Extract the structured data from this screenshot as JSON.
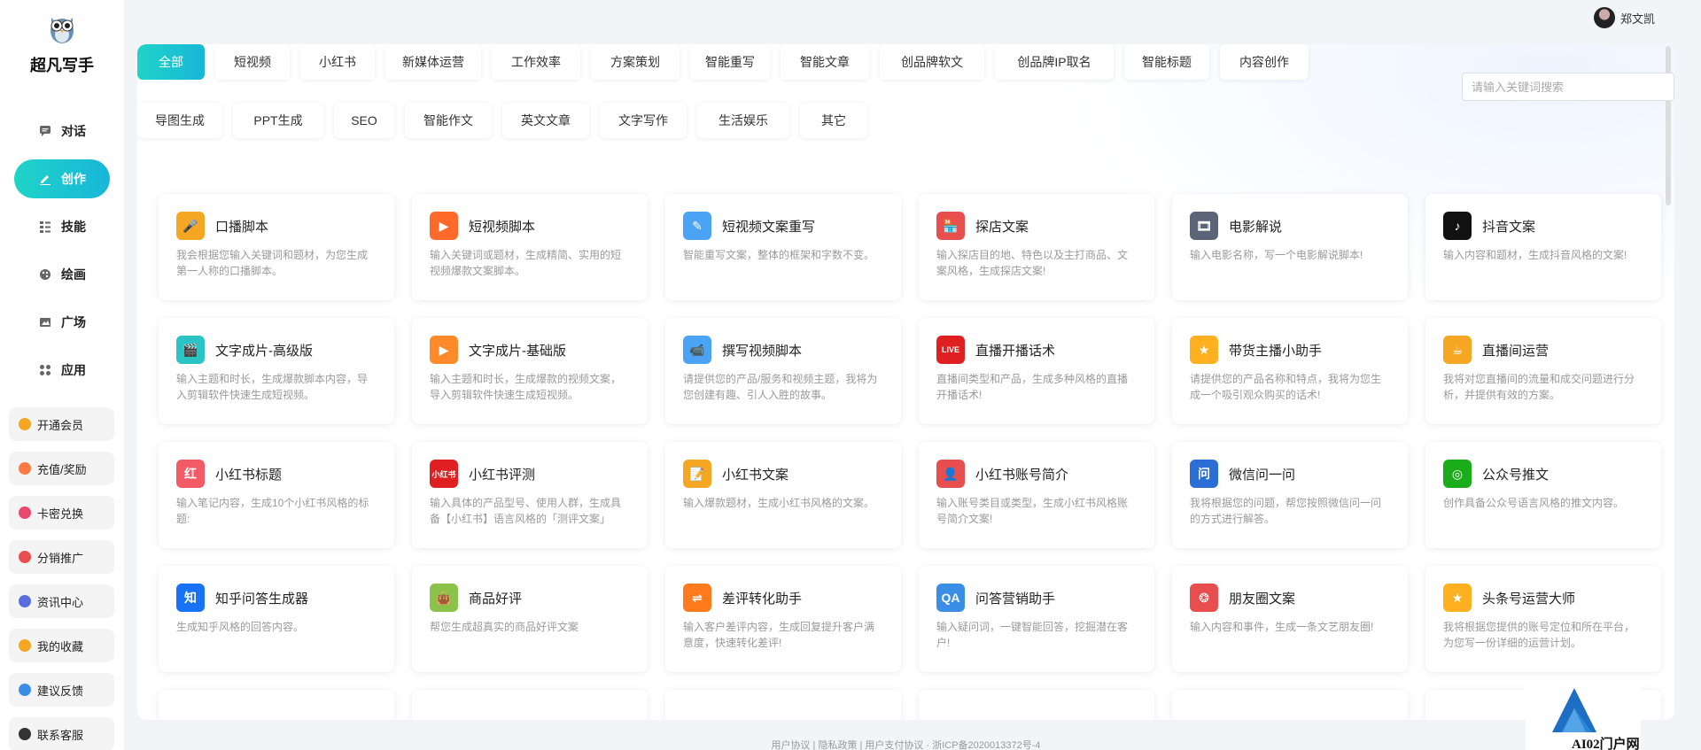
{
  "app": {
    "title": "超凡写手"
  },
  "user": {
    "name": "郑文凯"
  },
  "nav": [
    {
      "label": "对话",
      "icon": "chat-icon"
    },
    {
      "label": "创作",
      "icon": "pen-icon",
      "active": true
    },
    {
      "label": "技能",
      "icon": "list-icon"
    },
    {
      "label": "绘画",
      "icon": "palette-icon"
    },
    {
      "label": "广场",
      "icon": "image-icon"
    },
    {
      "label": "应用",
      "icon": "apps-icon"
    }
  ],
  "side_links": [
    {
      "label": "开通会员",
      "icon": "diamond-icon",
      "color": "#f5a623"
    },
    {
      "label": "充值/奖励",
      "icon": "coin-icon",
      "color": "#ff7a45"
    },
    {
      "label": "卡密兑换",
      "icon": "card-icon",
      "color": "#e8486e"
    },
    {
      "label": "分销推广",
      "icon": "share-icon",
      "color": "#e94e4e"
    },
    {
      "label": "资讯中心",
      "icon": "news-icon",
      "color": "#5b6ee1"
    },
    {
      "label": "我的收藏",
      "icon": "star-icon",
      "color": "#f5a623"
    },
    {
      "label": "建议反馈",
      "icon": "mail-icon",
      "color": "#3a8ee6"
    },
    {
      "label": "联系客服",
      "icon": "headset-icon",
      "color": "#333333"
    }
  ],
  "categories_row1": [
    "全部",
    "短视频",
    "小红书",
    "新媒体运营",
    "工作效率",
    "方案策划",
    "智能重写",
    "智能文章",
    "创品牌软文",
    "创品牌IP取名",
    "智能标题",
    "内容创作"
  ],
  "categories_row2": [
    "导图生成",
    "PPT生成",
    "SEO",
    "智能作文",
    "英文文章",
    "文字写作",
    "生活娱乐",
    "其它"
  ],
  "active_category": "全部",
  "search": {
    "placeholder": "请输入关键词搜索"
  },
  "cards": [
    {
      "title": "口播脚本",
      "desc": "我会根据您输入关键词和题材，为您生成第一人称的口播脚本。",
      "icon": "microphone-icon",
      "color": "#f5a623",
      "glyph": "🎤"
    },
    {
      "title": "短视频脚本",
      "desc": "输入关键词或题材，生成精简、实用的短视频爆款文案脚本。",
      "icon": "play-icon",
      "color": "#ff6a2a",
      "glyph": "▶"
    },
    {
      "title": "短视频文案重写",
      "desc": "智能重写文案，整体的框架和字数不变。",
      "icon": "eraser-icon",
      "color": "#4aa3f5",
      "glyph": "✎"
    },
    {
      "title": "探店文案",
      "desc": "输入探店目的地、特色以及主打商品、文案风格，生成探店文案!",
      "icon": "shop-icon",
      "color": "#e94e4e",
      "glyph": "🏪"
    },
    {
      "title": "电影解说",
      "desc": "输入电影名称，写一个电影解说脚本!",
      "icon": "film-icon",
      "color": "#5b6478",
      "glyph": "🎞"
    },
    {
      "title": "抖音文案",
      "desc": "输入内容和题材，生成抖音风格的文案!",
      "icon": "tiktok-icon",
      "color": "#111111",
      "glyph": "♪"
    },
    {
      "title": "文字成片-高级版",
      "desc": "输入主题和时长，生成爆款脚本内容，导入剪辑软件快速生成短视频。",
      "icon": "clapper-icon",
      "color": "#2bc4c4",
      "glyph": "🎬"
    },
    {
      "title": "文字成片-基础版",
      "desc": "输入主题和时长，生成爆款的视频文案，导入剪辑软件快速生成短视频。",
      "icon": "video-icon",
      "color": "#ff8a2a",
      "glyph": "▶"
    },
    {
      "title": "撰写视频脚本",
      "desc": "请提供您的产品/服务和视频主题，我将为您创建有趣、引人入胜的故事。",
      "icon": "camera-icon",
      "color": "#4aa3f5",
      "glyph": "📹"
    },
    {
      "title": "直播开播话术",
      "desc": "直播间类型和产品，生成多种风格的直播开播话术!",
      "icon": "live-icon",
      "color": "#e02020",
      "glyph": "LIVE"
    },
    {
      "title": "带货主播小助手",
      "desc": "请提供您的产品名称和特点，我将为您生成一个吸引观众购买的话术!",
      "icon": "star-badge-icon",
      "color": "#ffb020",
      "glyph": "★"
    },
    {
      "title": "直播间运营",
      "desc": "我将对您直播间的流量和成交问题进行分析，并提供有效的方案。",
      "icon": "cup-icon",
      "color": "#f5a623",
      "glyph": "☕"
    },
    {
      "title": "小红书标题",
      "desc": "输入笔记内容，生成10个小红书风格的标题:",
      "icon": "xhs-title-icon",
      "color": "#f25a66",
      "glyph": "红"
    },
    {
      "title": "小红书评测",
      "desc": "输入具体的产品型号、使用人群，生成具备【小红书】语言风格的「测评文案」",
      "icon": "xhs-icon",
      "color": "#e02020",
      "glyph": "小红书"
    },
    {
      "title": "小红书文案",
      "desc": "输入爆款题材，生成小红书风格的文案。",
      "icon": "notebook-icon",
      "color": "#f5a623",
      "glyph": "📝"
    },
    {
      "title": "小红书账号简介",
      "desc": "输入账号类目或类型，生成小红书风格账号简介文案!",
      "icon": "profile-icon",
      "color": "#e94e4e",
      "glyph": "👤"
    },
    {
      "title": "微信问一问",
      "desc": "我将根据您的问题，帮您按照微信问一问的方式进行解答。",
      "icon": "question-icon",
      "color": "#2b6fd6",
      "glyph": "问"
    },
    {
      "title": "公众号推文",
      "desc": "创作具备公众号语言风格的推文内容。",
      "icon": "wechat-icon",
      "color": "#1aad19",
      "glyph": "◎"
    },
    {
      "title": "知乎问答生成器",
      "desc": "生成知乎风格的回答内容。",
      "icon": "zhihu-icon",
      "color": "#1772f6",
      "glyph": "知"
    },
    {
      "title": "商品好评",
      "desc": "帮您生成超真实的商品好评文案",
      "icon": "bag-icon",
      "color": "#8bc34a",
      "glyph": "👜"
    },
    {
      "title": "差评转化助手",
      "desc": "输入客户差评内容，生成回复提升客户满意度，快速转化差评!",
      "icon": "exchange-icon",
      "color": "#ff7a1a",
      "glyph": "⇌"
    },
    {
      "title": "问答营销助手",
      "desc": "输入疑问词，一键智能回答，挖掘潜在客户!",
      "icon": "qa-icon",
      "color": "#3a8ee6",
      "glyph": "QA"
    },
    {
      "title": "朋友圈文案",
      "desc": "输入内容和事件，生成一条文艺朋友圈!",
      "icon": "aperture-icon",
      "color": "#e94e4e",
      "glyph": "❂"
    },
    {
      "title": "头条号运营大师",
      "desc": "我将根据您提供的账号定位和所在平台，为您写一份详细的运营计划。",
      "icon": "star-badge-icon",
      "color": "#ffb020",
      "glyph": "★"
    }
  ],
  "footer": {
    "text": "用户协议 | 隐私政策 | 用户支付协议 · 浙ICP备2020013372号-4"
  },
  "watermark": {
    "text": "AI02门户网"
  }
}
